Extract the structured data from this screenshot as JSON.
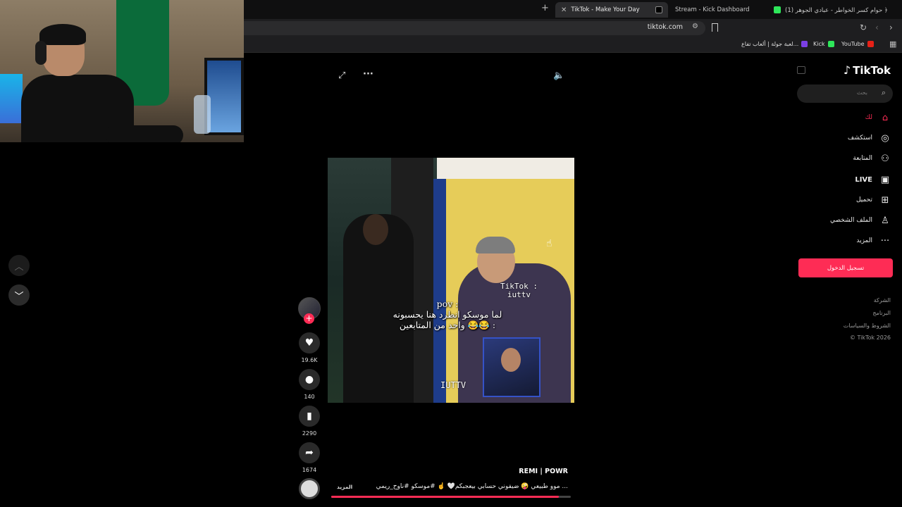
{
  "browser": {
    "tabs": [
      {
        "label": "(1) حوام كسر الخواطر - عبادي الجوهر ﴿",
        "active": false
      },
      {
        "label": "Stream - Kick Dashboard",
        "active": false
      },
      {
        "label": "TikTok - Make Your Day",
        "active": true
      }
    ],
    "url": "tiktok.com",
    "bookmarks": [
      "YouTube",
      "Kick",
      "لعبة جولة | ألعاب تفاع..."
    ]
  },
  "player": {
    "video_caption": "pov :\nلما موسكو انطرد هنا يحسبونه\nواحد من المتابعين 😂😂 :",
    "watermark": "TikTok :\niuttv",
    "watermark2": "IUTTV"
  },
  "actions": {
    "likes": "19.6K",
    "comments": "140",
    "saves": "2290",
    "shares": "1674"
  },
  "post": {
    "author": "REMI | POWR",
    "description": "موو طبيعي 🤪 ضيفوني حسابي  بيعجبكم🤍 ☝️ #موسكو #ناوح_ريمي ...",
    "more_label": "المزيد",
    "progress": 0.95
  },
  "sidebar": {
    "logo": "TikTok",
    "search_placeholder": "بحث",
    "nav": [
      {
        "label": "لك",
        "icon": "home-icon"
      },
      {
        "label": "استكشف",
        "icon": "compass-icon"
      },
      {
        "label": "المتابعة",
        "icon": "follow-icon"
      },
      {
        "label": "LIVE",
        "icon": "live-icon"
      },
      {
        "label": "تحميل",
        "icon": "upload-icon"
      },
      {
        "label": "الملف الشخصي",
        "icon": "profile-icon"
      },
      {
        "label": "المزيد",
        "icon": "more-icon"
      }
    ],
    "login_label": "تسجيل الدخول",
    "footer": [
      "الشركة",
      "البرنامج",
      "الشروط والسياسات",
      "© TikTok 2026"
    ]
  },
  "colors": {
    "accent": "#fe2c55",
    "background": "#000000"
  }
}
